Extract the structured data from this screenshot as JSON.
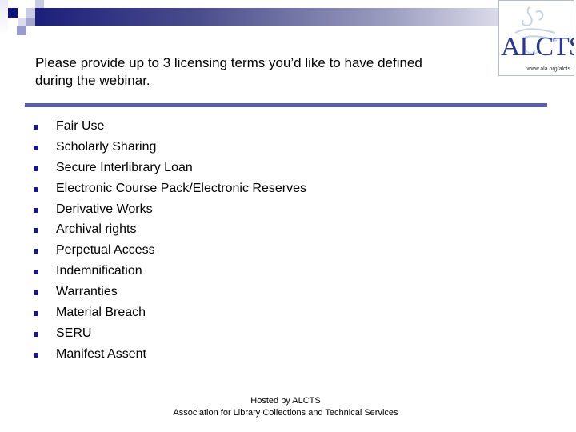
{
  "header": {
    "logo": {
      "name": "ALCTS",
      "url_text": "www.ala.org/alcts",
      "brand_color": "#2b3a8a"
    },
    "accent_color": "#1c1f7a",
    "rule_color": "#5b5ea6"
  },
  "slide": {
    "title_line1": "Please provide up to 3 licensing terms you’d like to have defined",
    "title_line2": "during the webinar.",
    "bullet_icon": "square-bullet",
    "items": [
      {
        "label": "Fair Use"
      },
      {
        "label": "Scholarly Sharing"
      },
      {
        "label": "Secure Interlibrary Loan"
      },
      {
        "label": "Electronic Course Pack/Electronic Reserves"
      },
      {
        "label": "Derivative Works"
      },
      {
        "label": "Archival rights"
      },
      {
        "label": "Perpetual Access"
      },
      {
        "label": "Indemnification"
      },
      {
        "label": "Warranties"
      },
      {
        "label": "Material Breach"
      },
      {
        "label": "SERU"
      },
      {
        "label": "Manifest Assent"
      }
    ]
  },
  "footer": {
    "line1": "Hosted by ALCTS",
    "line2": "Association for Library Collections and Technical Services"
  }
}
